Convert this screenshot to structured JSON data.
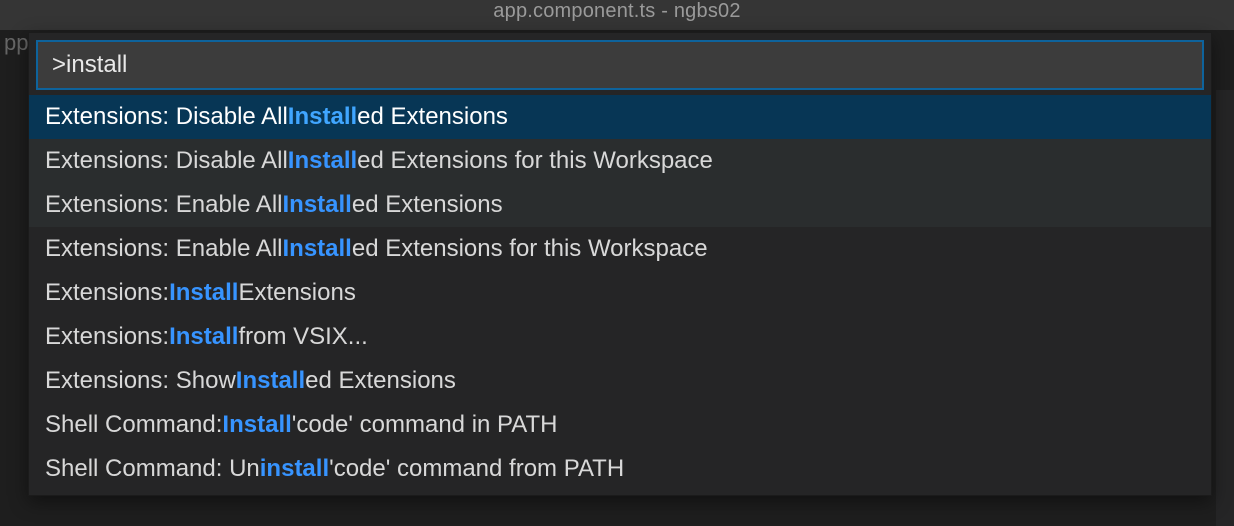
{
  "titlebar": "app.component.ts - ngbs02",
  "bg_text": "pp",
  "input_value": ">install",
  "query": "install",
  "results": [
    {
      "text": "Extensions: Disable All Installed Extensions",
      "state": "selected"
    },
    {
      "text": "Extensions: Disable All Installed Extensions for this Workspace",
      "state": "hovered"
    },
    {
      "text": "Extensions: Enable All Installed Extensions",
      "state": "hovered"
    },
    {
      "text": "Extensions: Enable All Installed Extensions for this Workspace",
      "state": ""
    },
    {
      "text": "Extensions: Install Extensions",
      "state": ""
    },
    {
      "text": "Extensions: Install from VSIX...",
      "state": ""
    },
    {
      "text": "Extensions: Show Installed Extensions",
      "state": ""
    },
    {
      "text": "Shell Command: Install 'code' command in PATH",
      "state": ""
    },
    {
      "text": "Shell Command: Uninstall 'code' command from PATH",
      "state": ""
    }
  ]
}
